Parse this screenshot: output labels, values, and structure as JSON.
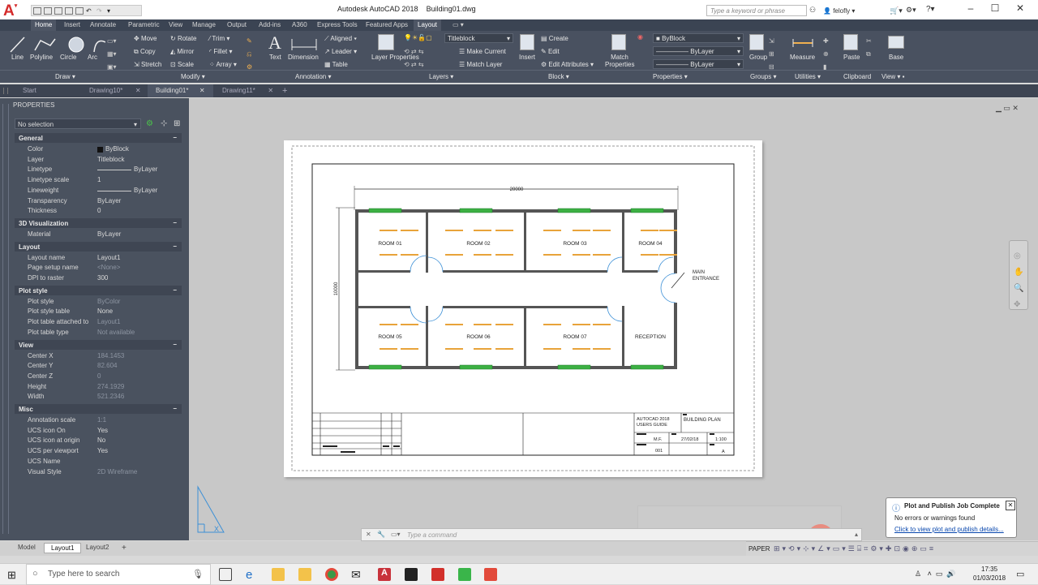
{
  "app": {
    "title": "Autodesk AutoCAD 2018",
    "document": "Building01.dwg",
    "logo": "A",
    "search_placeholder": "Type a keyword or phrase",
    "user": "felofly"
  },
  "ribbon_tabs": [
    "Home",
    "Insert",
    "Annotate",
    "Parametric",
    "View",
    "Manage",
    "Output",
    "Add-ins",
    "A360",
    "Express Tools",
    "Featured Apps",
    "Layout"
  ],
  "ribbon": {
    "draw": {
      "title": "Draw",
      "line": "Line",
      "polyline": "Polyline",
      "circle": "Circle",
      "arc": "Arc"
    },
    "modify": {
      "title": "Modify",
      "move": "Move",
      "rotate": "Rotate",
      "trim": "Trim",
      "copy": "Copy",
      "mirror": "Mirror",
      "fillet": "Fillet",
      "stretch": "Stretch",
      "scale": "Scale",
      "array": "Array"
    },
    "annotation": {
      "title": "Annotation",
      "text": "Text",
      "dimension": "Dimension",
      "aligned": "Aligned",
      "leader": "Leader",
      "table": "Table"
    },
    "layers": {
      "title": "Layers",
      "layer_properties": "Layer Properties",
      "current_layer": "Titleblock",
      "make_current": "Make Current",
      "match_layer": "Match Layer"
    },
    "block": {
      "title": "Block",
      "insert": "Insert",
      "create": "Create",
      "edit": "Edit",
      "edit_attributes": "Edit Attributes"
    },
    "properties": {
      "title": "Properties",
      "match": "Match Properties",
      "color": "ByBlock",
      "linetype": "ByLayer",
      "lineweight": "ByLayer"
    },
    "groups": {
      "title": "Groups",
      "group": "Group"
    },
    "utilities": {
      "title": "Utilities",
      "measure": "Measure"
    },
    "clipboard": {
      "title": "Clipboard",
      "paste": "Paste"
    },
    "view": {
      "title": "View",
      "base": "Base"
    }
  },
  "doc_tabs": [
    "Start",
    "Drawing10*",
    "Building01*",
    "Drawing11*"
  ],
  "properties_panel": {
    "title": "PROPERTIES",
    "selection": "No selection",
    "general": {
      "title": "General",
      "rows": [
        [
          "Color",
          "ByBlock"
        ],
        [
          "Layer",
          "Titleblock"
        ],
        [
          "Linetype",
          "ByLayer"
        ],
        [
          "Linetype scale",
          "1"
        ],
        [
          "Lineweight",
          "ByLayer"
        ],
        [
          "Transparency",
          "ByLayer"
        ],
        [
          "Thickness",
          "0"
        ]
      ]
    },
    "viz": {
      "title": "3D Visualization",
      "rows": [
        [
          "Material",
          "ByLayer"
        ]
      ]
    },
    "layout": {
      "title": "Layout",
      "rows": [
        [
          "Layout name",
          "Layout1"
        ],
        [
          "Page setup name",
          "<None>"
        ],
        [
          "DPI to raster",
          "300"
        ]
      ]
    },
    "plot": {
      "title": "Plot style",
      "rows": [
        [
          "Plot style",
          "ByColor"
        ],
        [
          "Plot style table",
          "None"
        ],
        [
          "Plot table attached to",
          "Layout1"
        ],
        [
          "Plot table type",
          "Not available"
        ]
      ]
    },
    "view": {
      "title": "View",
      "rows": [
        [
          "Center X",
          "184.1453"
        ],
        [
          "Center Y",
          "82.604"
        ],
        [
          "Center Z",
          "0"
        ],
        [
          "Height",
          "274.1929"
        ],
        [
          "Width",
          "521.2346"
        ]
      ]
    },
    "misc": {
      "title": "Misc",
      "rows": [
        [
          "Annotation scale",
          "1:1"
        ],
        [
          "UCS icon On",
          "Yes"
        ],
        [
          "UCS icon at origin",
          "No"
        ],
        [
          "UCS per viewport",
          "Yes"
        ],
        [
          "UCS Name",
          ""
        ],
        [
          "Visual Style",
          "2D Wireframe"
        ]
      ]
    }
  },
  "drawing": {
    "dim_horizontal": "20000",
    "dim_vertical": "10000",
    "rooms": [
      "ROOM 01",
      "ROOM 02",
      "ROOM 03",
      "ROOM 04",
      "ROOM 05",
      "ROOM 06",
      "ROOM 07",
      "RECEPTION"
    ],
    "entrance": "MAIN ENTRANCE",
    "titleblock": {
      "guide": "AUTOCAD 2018 USERS GUIDE",
      "title": "BUILDING PLAN",
      "author": "M.F.",
      "date": "27/02/18",
      "scale": "1:100",
      "number": "001",
      "rev": "A"
    }
  },
  "command": {
    "placeholder": "Type a command"
  },
  "layout_tabs": [
    "Model",
    "Layout1",
    "Layout2"
  ],
  "status": {
    "space": "PAPER"
  },
  "notification": {
    "title": "Plot and Publish Job Complete",
    "message": "No errors or warnings found",
    "link": "Click to view plot and publish details..."
  },
  "recording": "rec",
  "taskbar": {
    "search": "Type here to search",
    "time": "17:35",
    "date": "01/03/2018"
  },
  "colors": {
    "ribbon": "#495160",
    "window_green": "#3cb043",
    "light_orange": "#e8a33a",
    "door_blue": "#3b8fd6",
    "autocad_red": "#d42b2b"
  }
}
